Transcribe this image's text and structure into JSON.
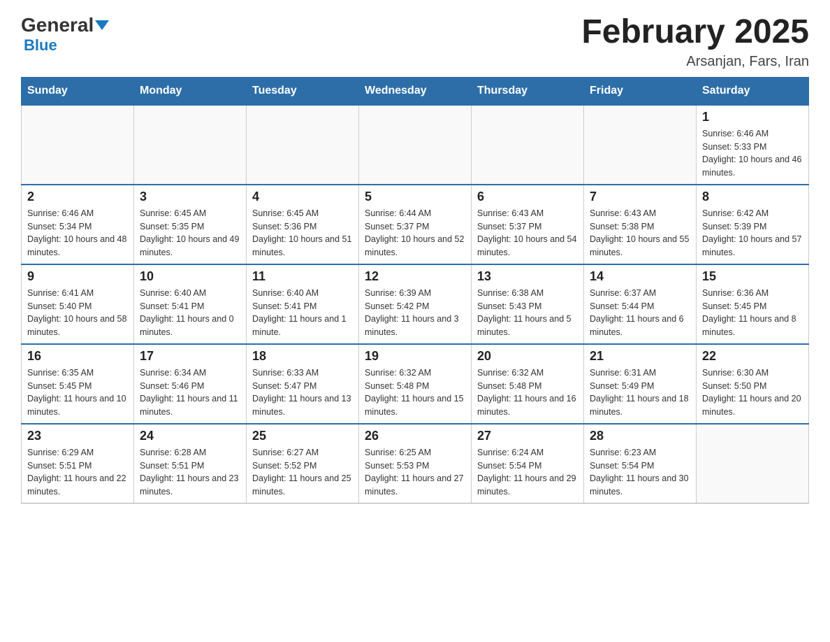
{
  "header": {
    "logo_general": "General",
    "logo_blue": "Blue",
    "month_title": "February 2025",
    "location": "Arsanjan, Fars, Iran"
  },
  "days_of_week": [
    "Sunday",
    "Monday",
    "Tuesday",
    "Wednesday",
    "Thursday",
    "Friday",
    "Saturday"
  ],
  "weeks": [
    [
      {
        "day": "",
        "sunrise": "",
        "sunset": "",
        "daylight": ""
      },
      {
        "day": "",
        "sunrise": "",
        "sunset": "",
        "daylight": ""
      },
      {
        "day": "",
        "sunrise": "",
        "sunset": "",
        "daylight": ""
      },
      {
        "day": "",
        "sunrise": "",
        "sunset": "",
        "daylight": ""
      },
      {
        "day": "",
        "sunrise": "",
        "sunset": "",
        "daylight": ""
      },
      {
        "day": "",
        "sunrise": "",
        "sunset": "",
        "daylight": ""
      },
      {
        "day": "1",
        "sunrise": "Sunrise: 6:46 AM",
        "sunset": "Sunset: 5:33 PM",
        "daylight": "Daylight: 10 hours and 46 minutes."
      }
    ],
    [
      {
        "day": "2",
        "sunrise": "Sunrise: 6:46 AM",
        "sunset": "Sunset: 5:34 PM",
        "daylight": "Daylight: 10 hours and 48 minutes."
      },
      {
        "day": "3",
        "sunrise": "Sunrise: 6:45 AM",
        "sunset": "Sunset: 5:35 PM",
        "daylight": "Daylight: 10 hours and 49 minutes."
      },
      {
        "day": "4",
        "sunrise": "Sunrise: 6:45 AM",
        "sunset": "Sunset: 5:36 PM",
        "daylight": "Daylight: 10 hours and 51 minutes."
      },
      {
        "day": "5",
        "sunrise": "Sunrise: 6:44 AM",
        "sunset": "Sunset: 5:37 PM",
        "daylight": "Daylight: 10 hours and 52 minutes."
      },
      {
        "day": "6",
        "sunrise": "Sunrise: 6:43 AM",
        "sunset": "Sunset: 5:37 PM",
        "daylight": "Daylight: 10 hours and 54 minutes."
      },
      {
        "day": "7",
        "sunrise": "Sunrise: 6:43 AM",
        "sunset": "Sunset: 5:38 PM",
        "daylight": "Daylight: 10 hours and 55 minutes."
      },
      {
        "day": "8",
        "sunrise": "Sunrise: 6:42 AM",
        "sunset": "Sunset: 5:39 PM",
        "daylight": "Daylight: 10 hours and 57 minutes."
      }
    ],
    [
      {
        "day": "9",
        "sunrise": "Sunrise: 6:41 AM",
        "sunset": "Sunset: 5:40 PM",
        "daylight": "Daylight: 10 hours and 58 minutes."
      },
      {
        "day": "10",
        "sunrise": "Sunrise: 6:40 AM",
        "sunset": "Sunset: 5:41 PM",
        "daylight": "Daylight: 11 hours and 0 minutes."
      },
      {
        "day": "11",
        "sunrise": "Sunrise: 6:40 AM",
        "sunset": "Sunset: 5:41 PM",
        "daylight": "Daylight: 11 hours and 1 minute."
      },
      {
        "day": "12",
        "sunrise": "Sunrise: 6:39 AM",
        "sunset": "Sunset: 5:42 PM",
        "daylight": "Daylight: 11 hours and 3 minutes."
      },
      {
        "day": "13",
        "sunrise": "Sunrise: 6:38 AM",
        "sunset": "Sunset: 5:43 PM",
        "daylight": "Daylight: 11 hours and 5 minutes."
      },
      {
        "day": "14",
        "sunrise": "Sunrise: 6:37 AM",
        "sunset": "Sunset: 5:44 PM",
        "daylight": "Daylight: 11 hours and 6 minutes."
      },
      {
        "day": "15",
        "sunrise": "Sunrise: 6:36 AM",
        "sunset": "Sunset: 5:45 PM",
        "daylight": "Daylight: 11 hours and 8 minutes."
      }
    ],
    [
      {
        "day": "16",
        "sunrise": "Sunrise: 6:35 AM",
        "sunset": "Sunset: 5:45 PM",
        "daylight": "Daylight: 11 hours and 10 minutes."
      },
      {
        "day": "17",
        "sunrise": "Sunrise: 6:34 AM",
        "sunset": "Sunset: 5:46 PM",
        "daylight": "Daylight: 11 hours and 11 minutes."
      },
      {
        "day": "18",
        "sunrise": "Sunrise: 6:33 AM",
        "sunset": "Sunset: 5:47 PM",
        "daylight": "Daylight: 11 hours and 13 minutes."
      },
      {
        "day": "19",
        "sunrise": "Sunrise: 6:32 AM",
        "sunset": "Sunset: 5:48 PM",
        "daylight": "Daylight: 11 hours and 15 minutes."
      },
      {
        "day": "20",
        "sunrise": "Sunrise: 6:32 AM",
        "sunset": "Sunset: 5:48 PM",
        "daylight": "Daylight: 11 hours and 16 minutes."
      },
      {
        "day": "21",
        "sunrise": "Sunrise: 6:31 AM",
        "sunset": "Sunset: 5:49 PM",
        "daylight": "Daylight: 11 hours and 18 minutes."
      },
      {
        "day": "22",
        "sunrise": "Sunrise: 6:30 AM",
        "sunset": "Sunset: 5:50 PM",
        "daylight": "Daylight: 11 hours and 20 minutes."
      }
    ],
    [
      {
        "day": "23",
        "sunrise": "Sunrise: 6:29 AM",
        "sunset": "Sunset: 5:51 PM",
        "daylight": "Daylight: 11 hours and 22 minutes."
      },
      {
        "day": "24",
        "sunrise": "Sunrise: 6:28 AM",
        "sunset": "Sunset: 5:51 PM",
        "daylight": "Daylight: 11 hours and 23 minutes."
      },
      {
        "day": "25",
        "sunrise": "Sunrise: 6:27 AM",
        "sunset": "Sunset: 5:52 PM",
        "daylight": "Daylight: 11 hours and 25 minutes."
      },
      {
        "day": "26",
        "sunrise": "Sunrise: 6:25 AM",
        "sunset": "Sunset: 5:53 PM",
        "daylight": "Daylight: 11 hours and 27 minutes."
      },
      {
        "day": "27",
        "sunrise": "Sunrise: 6:24 AM",
        "sunset": "Sunset: 5:54 PM",
        "daylight": "Daylight: 11 hours and 29 minutes."
      },
      {
        "day": "28",
        "sunrise": "Sunrise: 6:23 AM",
        "sunset": "Sunset: 5:54 PM",
        "daylight": "Daylight: 11 hours and 30 minutes."
      },
      {
        "day": "",
        "sunrise": "",
        "sunset": "",
        "daylight": ""
      }
    ]
  ]
}
